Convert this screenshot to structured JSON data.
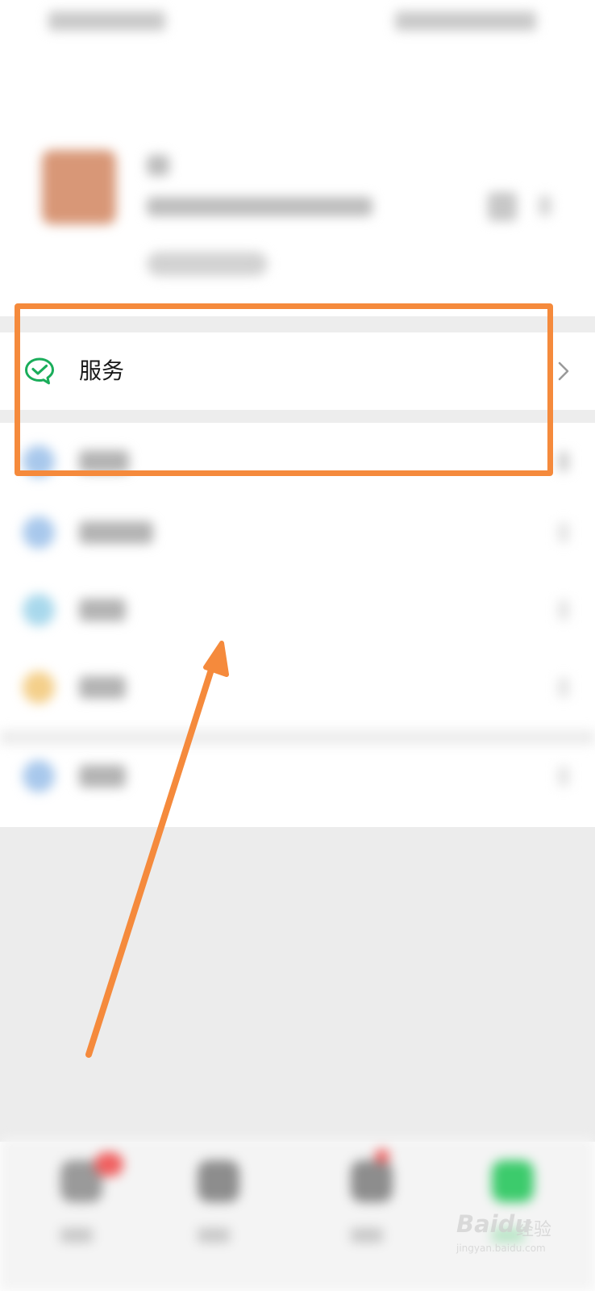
{
  "service_row": {
    "label": "服务",
    "icon": "wechat-pay-icon",
    "icon_color": "#1aad5a"
  },
  "menu_items": [
    {
      "icon": "collection-icon",
      "icon_color": "#a8c8ec"
    },
    {
      "icon": "moments-icon",
      "icon_color": "#a8c8ec"
    },
    {
      "icon": "cards-icon",
      "icon_color": "#a8d8ec"
    },
    {
      "icon": "sticker-icon",
      "icon_color": "#f4cf8a"
    },
    {
      "icon": "settings-icon",
      "icon_color": "#a8c8ec"
    }
  ],
  "tab_bar": {
    "tabs": [
      {
        "icon": "chats-icon",
        "has_badge": true
      },
      {
        "icon": "contacts-icon",
        "has_badge": false
      },
      {
        "icon": "discover-icon",
        "has_badge": true
      },
      {
        "icon": "me-icon",
        "has_badge": false,
        "active": true
      }
    ],
    "active_color": "#3ccb6c"
  },
  "annotation": {
    "highlight_color": "#f58a3c"
  },
  "watermark": {
    "brand": "Baidu",
    "sub": "经验",
    "url": "jingyan.baidu.com"
  }
}
